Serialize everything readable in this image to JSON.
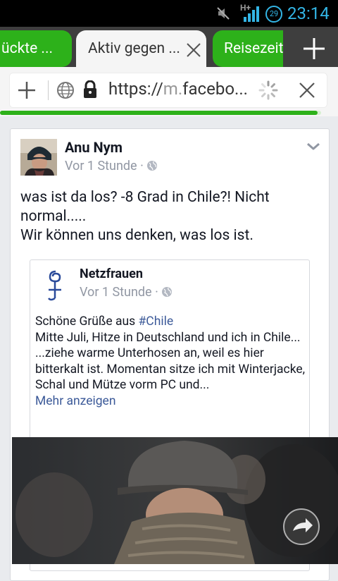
{
  "status": {
    "network": "H+",
    "notification_count": "29",
    "time": "23:14"
  },
  "tabs": [
    {
      "label": "ückte ..."
    },
    {
      "label": "Aktiv gegen ..."
    },
    {
      "label": "Reisezeit"
    }
  ],
  "address_bar": {
    "scheme": "https://",
    "host_dim": "m.",
    "host": "facebo...",
    "load_progress": 0.99
  },
  "post": {
    "author": "Anu Nym",
    "time": "Vor 1 Stunde",
    "separator": "·",
    "text_line1": "was ist da los? -8 Grad in Chile?! Nicht normal.....",
    "text_line2": "Wir können uns denken, was los ist.",
    "shared": {
      "author": "Netzfrauen",
      "time": "Vor 1 Stunde",
      "separator": "·",
      "line1_prefix": "Schöne Grüße aus ",
      "hashtag": "#Chile",
      "line2": "Mitte Juli, Hitze in Deutschland und ich in Chile...",
      "line3": "...ziehe warme Unterhosen an, weil es hier bitterkalt ist. Momentan sitze ich mit Winterjacke, Schal und Mütze vorm PC und...",
      "more_label": "Mehr anzeigen"
    }
  },
  "colors": {
    "accent_green": "#2db11a",
    "status_blue": "#33b5e5",
    "link_blue": "#3b5998"
  }
}
